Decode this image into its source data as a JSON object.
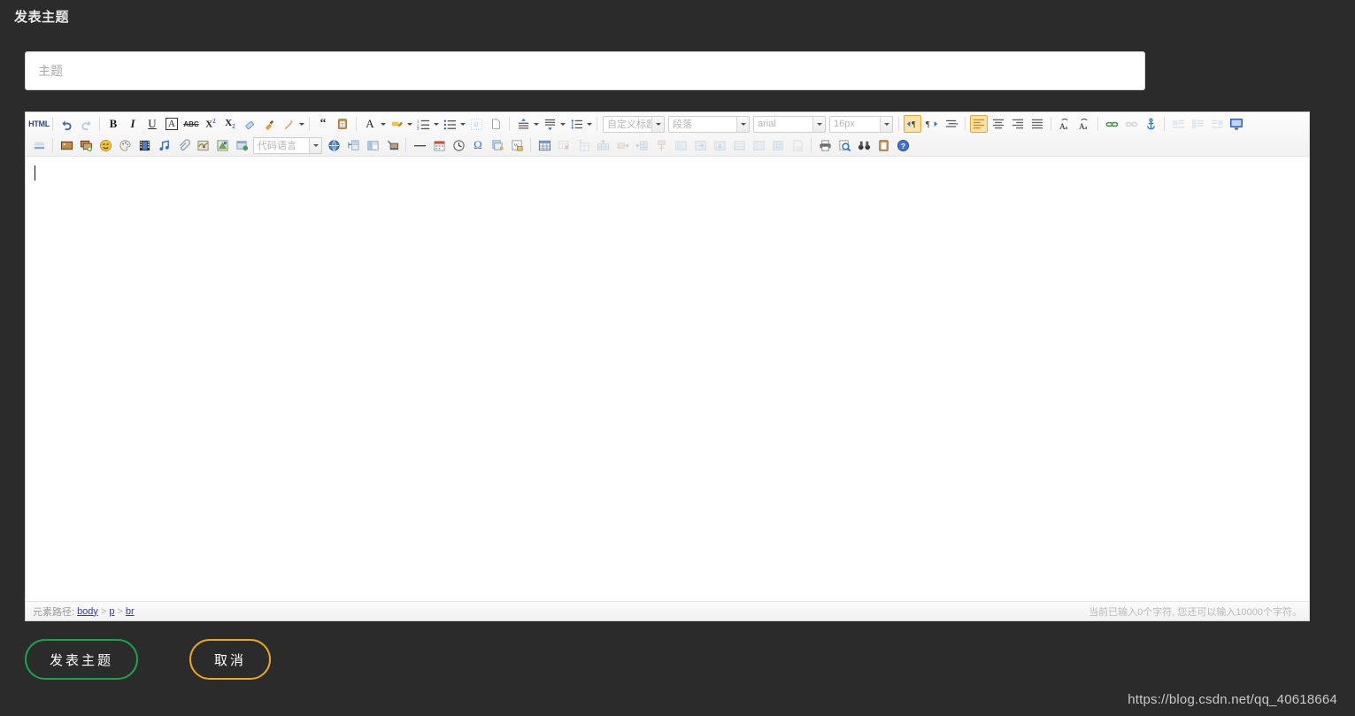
{
  "header": {
    "title": "发表主题"
  },
  "title_field": {
    "placeholder": "主题",
    "value": ""
  },
  "editor": {
    "toolbar_row1": [
      {
        "name": "source-html-button",
        "label": "HTML",
        "icon": "html-icon",
        "state": "normal"
      },
      {
        "name": "undo-button",
        "label": "撤销",
        "icon": "undo-icon",
        "state": "normal"
      },
      {
        "name": "redo-button",
        "label": "重做",
        "icon": "redo-icon",
        "state": "dim"
      },
      {
        "name": "bold-button",
        "label": "加粗",
        "icon": "bold-icon",
        "state": "normal"
      },
      {
        "name": "italic-button",
        "label": "斜体",
        "icon": "italic-icon",
        "state": "normal"
      },
      {
        "name": "underline-button",
        "label": "下划线",
        "icon": "underline-icon",
        "state": "normal"
      },
      {
        "name": "border-text-button",
        "label": "边框",
        "icon": "boxed-a-icon",
        "state": "normal"
      },
      {
        "name": "strikethrough-button",
        "label": "删除线",
        "icon": "strikethrough-icon",
        "state": "normal"
      },
      {
        "name": "superscript-button",
        "label": "上标",
        "icon": "superscript-icon",
        "state": "normal"
      },
      {
        "name": "subscript-button",
        "label": "下标",
        "icon": "subscript-icon",
        "state": "normal"
      },
      {
        "name": "remove-format-button",
        "label": "清除格式",
        "icon": "eraser-icon",
        "state": "normal"
      },
      {
        "name": "format-painter-button",
        "label": "格式刷",
        "icon": "paintbrush-icon",
        "state": "normal"
      },
      {
        "name": "auto-typeset-button",
        "label": "自动排版",
        "icon": "magic-wand-icon",
        "state": "normal"
      },
      {
        "name": "blockquote-button",
        "label": "引用",
        "icon": "quote-icon",
        "state": "normal"
      },
      {
        "name": "paste-plain-button",
        "label": "纯文本粘贴",
        "icon": "paste-text-icon",
        "state": "normal"
      },
      {
        "name": "font-color-button",
        "label": "字体颜色",
        "icon": "font-color-icon",
        "state": "normal"
      },
      {
        "name": "highlight-color-button",
        "label": "背景色",
        "icon": "highlighter-icon",
        "state": "normal"
      },
      {
        "name": "ordered-list-button",
        "label": "有序列表",
        "icon": "ordered-list-icon",
        "state": "normal"
      },
      {
        "name": "unordered-list-button",
        "label": "无序列表",
        "icon": "unordered-list-icon",
        "state": "normal"
      },
      {
        "name": "anchor-text-button",
        "label": "锚点",
        "icon": "a-badge-icon",
        "state": "dim"
      },
      {
        "name": "new-document-button",
        "label": "新建",
        "icon": "blank-page-icon",
        "state": "normal"
      },
      {
        "name": "paragraph-spacing-top-button",
        "label": "段前距",
        "icon": "space-before-icon",
        "state": "normal"
      },
      {
        "name": "paragraph-spacing-bottom-button",
        "label": "段后距",
        "icon": "space-after-icon",
        "state": "normal"
      },
      {
        "name": "line-height-button",
        "label": "行间距",
        "icon": "line-height-icon",
        "state": "normal"
      }
    ],
    "selects_row1": [
      {
        "name": "custom-heading-select",
        "value": "自定义标题"
      },
      {
        "name": "paragraph-format-select",
        "value": "段落"
      },
      {
        "name": "font-family-select",
        "value": "arial"
      },
      {
        "name": "font-size-select",
        "value": "16px"
      }
    ],
    "toolbar_row1_tail": [
      {
        "name": "direction-ltr-button",
        "label": "从左向右",
        "icon": "ltr-icon",
        "state": "active"
      },
      {
        "name": "direction-rtl-button",
        "label": "从右向左",
        "icon": "rtl-icon",
        "state": "normal"
      },
      {
        "name": "indent-button",
        "label": "首行缩进",
        "icon": "indent-icon",
        "state": "normal"
      },
      {
        "name": "align-left-button",
        "label": "左对齐",
        "icon": "align-left-icon",
        "state": "active"
      },
      {
        "name": "align-center-button",
        "label": "居中",
        "icon": "align-center-icon",
        "state": "normal"
      },
      {
        "name": "align-right-button",
        "label": "右对齐",
        "icon": "align-right-icon",
        "state": "normal"
      },
      {
        "name": "align-justify-button",
        "label": "两端对齐",
        "icon": "align-justify-icon",
        "state": "normal"
      },
      {
        "name": "uppercase-button",
        "label": "字母大写",
        "icon": "uppercase-icon",
        "state": "normal"
      },
      {
        "name": "lowercase-button",
        "label": "字母小写",
        "icon": "lowercase-icon",
        "state": "normal"
      },
      {
        "name": "insert-link-button",
        "label": "超链接",
        "icon": "link-icon",
        "state": "normal"
      },
      {
        "name": "unlink-button",
        "label": "取消链接",
        "icon": "unlink-icon",
        "state": "dim"
      },
      {
        "name": "insert-anchor-button",
        "label": "锚点",
        "icon": "anchor-icon",
        "state": "normal"
      },
      {
        "name": "image-float-left-button",
        "label": "左浮动",
        "icon": "image-left-icon",
        "state": "dim"
      },
      {
        "name": "image-float-center-button",
        "label": "居中浮动",
        "icon": "image-center-icon",
        "state": "dim"
      },
      {
        "name": "image-float-right-button",
        "label": "右浮动",
        "icon": "image-right-icon",
        "state": "dim"
      },
      {
        "name": "fullscreen-button",
        "label": "全屏",
        "icon": "monitor-icon",
        "state": "normal"
      }
    ],
    "toolbar_row2": [
      {
        "name": "background-button",
        "label": "背景",
        "icon": "background-icon",
        "state": "normal"
      },
      {
        "name": "insert-image-button",
        "label": "图片",
        "icon": "image-icon",
        "state": "normal"
      },
      {
        "name": "batch-image-button",
        "label": "多图上传",
        "icon": "multi-image-icon",
        "state": "normal"
      },
      {
        "name": "emoticon-button",
        "label": "表情",
        "icon": "smiley-icon",
        "state": "normal"
      },
      {
        "name": "scrawl-button",
        "label": "涂鸦",
        "icon": "palette-icon",
        "state": "normal"
      },
      {
        "name": "insert-video-button",
        "label": "视频",
        "icon": "film-icon",
        "state": "normal"
      },
      {
        "name": "insert-music-button",
        "label": "音乐",
        "icon": "music-icon",
        "state": "normal"
      },
      {
        "name": "attachment-button",
        "label": "附件",
        "icon": "paperclip-icon",
        "state": "normal"
      },
      {
        "name": "insert-map-button",
        "label": "地图",
        "icon": "map-icon",
        "state": "normal"
      },
      {
        "name": "gmap-button",
        "label": "谷歌地图",
        "icon": "gmap-icon",
        "state": "normal"
      },
      {
        "name": "webapp-button",
        "label": "应用",
        "icon": "webapp-icon",
        "state": "normal"
      }
    ],
    "code_language_select": {
      "name": "code-language-select",
      "value": "代码语言"
    },
    "toolbar_row2b": [
      {
        "name": "insert-code-button",
        "label": "插入代码",
        "icon": "globe-icon",
        "state": "normal"
      },
      {
        "name": "template-button",
        "label": "模板",
        "icon": "template-icon",
        "state": "normal"
      },
      {
        "name": "layout-button",
        "label": "布局",
        "icon": "layout-icon",
        "state": "normal"
      },
      {
        "name": "screenshot-button",
        "label": "截图",
        "icon": "screenshot-icon",
        "state": "normal"
      },
      {
        "name": "horizontal-rule-button",
        "label": "分隔线",
        "icon": "hr-icon",
        "state": "normal"
      },
      {
        "name": "insert-date-button",
        "label": "日期",
        "icon": "calendar-icon",
        "state": "normal"
      },
      {
        "name": "insert-time-button",
        "label": "时间",
        "icon": "clock-icon",
        "state": "normal"
      },
      {
        "name": "special-character-button",
        "label": "特殊字符",
        "icon": "omega-icon",
        "state": "normal"
      },
      {
        "name": "page-break-button",
        "label": "分页",
        "icon": "page-break-icon",
        "state": "normal"
      },
      {
        "name": "word-import-button",
        "label": "导入Word",
        "icon": "word-icon",
        "state": "normal"
      }
    ],
    "toolbar_row2_tables": [
      {
        "name": "insert-table-button",
        "label": "插入表格",
        "icon": "table-icon",
        "state": "normal"
      },
      {
        "name": "delete-table-button",
        "label": "删除表格",
        "icon": "table-delete-icon",
        "state": "dim"
      },
      {
        "name": "table-properties-button",
        "label": "表格属性",
        "icon": "table-props-icon",
        "state": "dim"
      },
      {
        "name": "insert-row-button",
        "label": "插入行",
        "icon": "insert-row-icon",
        "state": "dim"
      },
      {
        "name": "insert-col-button",
        "label": "插入列",
        "icon": "insert-col-icon",
        "state": "dim"
      },
      {
        "name": "merge-cells-button",
        "label": "合并单元格",
        "icon": "merge-cells-icon",
        "state": "dim"
      },
      {
        "name": "split-cell-button",
        "label": "拆分单元格",
        "icon": "split-cell-icon",
        "state": "dim"
      },
      {
        "name": "merge-right-button",
        "label": "向右合并",
        "icon": "merge-right-icon",
        "state": "dim"
      },
      {
        "name": "merge-down-button",
        "label": "向下合并",
        "icon": "merge-down-icon",
        "state": "dim"
      },
      {
        "name": "split-rows-button",
        "label": "完全拆分",
        "icon": "split-rows-icon",
        "state": "dim"
      },
      {
        "name": "split-cols-button",
        "label": "拆分成列",
        "icon": "split-cols-icon",
        "state": "dim"
      },
      {
        "name": "table-sort-button",
        "label": "表格排序",
        "icon": "table-sort-icon",
        "state": "dim"
      },
      {
        "name": "delete-row-button",
        "label": "删除行",
        "icon": "delete-row-icon",
        "state": "dim"
      }
    ],
    "toolbar_row2_tail": [
      {
        "name": "print-button",
        "label": "打印",
        "icon": "printer-icon",
        "state": "normal"
      },
      {
        "name": "print-preview-button",
        "label": "预览",
        "icon": "preview-icon",
        "state": "normal"
      },
      {
        "name": "search-replace-button",
        "label": "查询替换",
        "icon": "binoculars-icon",
        "state": "normal"
      },
      {
        "name": "clipboard-button",
        "label": "剪贴板",
        "icon": "clipboard-icon",
        "state": "normal"
      },
      {
        "name": "help-button",
        "label": "帮助",
        "icon": "help-icon",
        "state": "normal"
      }
    ],
    "content": "",
    "statusbar": {
      "path_label": "元素路径:",
      "path_items": [
        "body",
        "p",
        "br"
      ],
      "separator": ">",
      "word_count": "当前已输入0个字符, 您还可以输入10000个字符。"
    }
  },
  "footer": {
    "submit_label": "发表主题",
    "cancel_label": "取消",
    "submit_color": "#17a54a",
    "cancel_color": "#e8a81c"
  },
  "watermark": "https://blog.csdn.net/qq_40618664",
  "colors": {
    "background": "#2b2b2b",
    "active_toolbar": "#fbe3a5",
    "link": "#2b39c9"
  }
}
